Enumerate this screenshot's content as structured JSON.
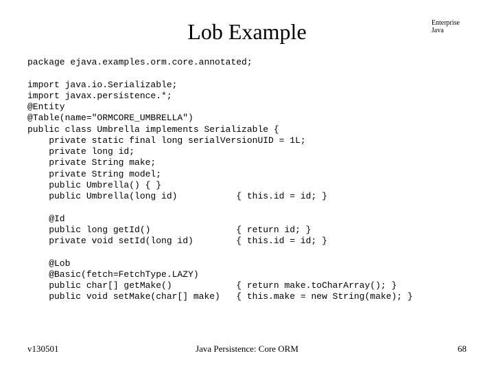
{
  "corner": {
    "line1": "Enterprise",
    "line2": "Java"
  },
  "title": "Lob Example",
  "code": "package ejava.examples.orm.core.annotated;\n\nimport java.io.Serializable;\nimport javax.persistence.*;\n@Entity\n@Table(name=\"ORMCORE_UMBRELLA\")\npublic class Umbrella implements Serializable {\n    private static final long serialVersionUID = 1L;\n    private long id;\n    private String make;\n    private String model;\n    public Umbrella() { }\n    public Umbrella(long id)           { this.id = id; }\n\n    @Id\n    public long getId()                { return id; }\n    private void setId(long id)        { this.id = id; }\n\n    @Lob\n    @Basic(fetch=FetchType.LAZY)\n    public char[] getMake()            { return make.toCharArray(); }\n    public void setMake(char[] make)   { this.make = new String(make); }",
  "footer": {
    "left": "v130501",
    "center": "Java Persistence: Core ORM",
    "page": "68"
  }
}
